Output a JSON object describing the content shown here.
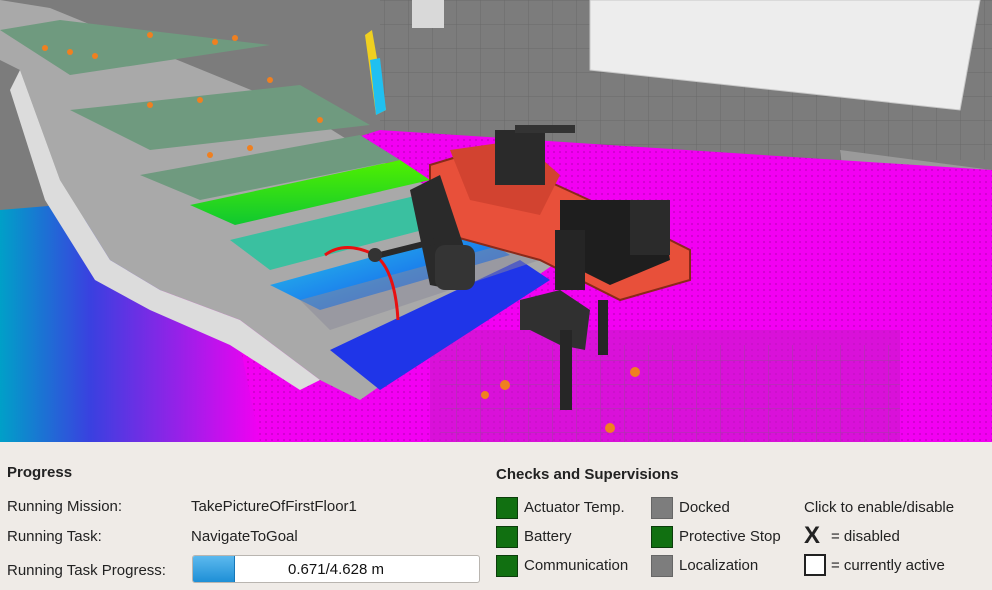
{
  "progress": {
    "title": "Progress",
    "mission_label": "Running Mission:",
    "mission_value": "TakePictureOfFirstFloor1",
    "task_label": "Running Task:",
    "task_value": "NavigateToGoal",
    "task_progress_label": "Running Task Progress:",
    "task_progress_text": "0.671/4.628 m",
    "task_progress_current": 0.671,
    "task_progress_total": 4.628
  },
  "checks": {
    "title": "Checks and Supervisions",
    "items": [
      {
        "label": "Actuator Temp.",
        "state": "green"
      },
      {
        "label": "Battery",
        "state": "green"
      },
      {
        "label": "Communication",
        "state": "green"
      },
      {
        "label": "Docked",
        "state": "gray"
      },
      {
        "label": "Protective Stop",
        "state": "green"
      },
      {
        "label": "Localization",
        "state": "gray"
      }
    ],
    "help_text": "Click to enable/disable",
    "disabled_symbol": "X",
    "disabled_text": "= disabled",
    "active_text": "= currently active"
  },
  "colors": {
    "ok_green": "#117011",
    "inactive_gray": "#7d7d7d",
    "progress_blue": "#1e8fd6",
    "terrain_magenta": "#f200f2",
    "robot_orange": "#e8503a"
  }
}
